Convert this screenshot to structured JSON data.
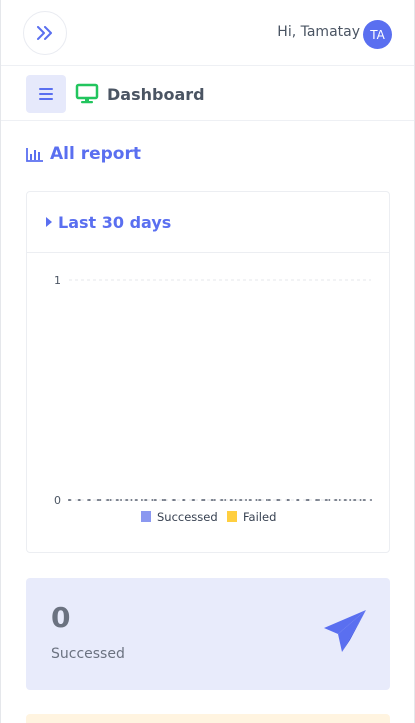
{
  "header": {
    "greeting": "Hi, Tamatay",
    "avatar_initials": "TA"
  },
  "subheader": {
    "title": "Dashboard"
  },
  "section": {
    "title": "All report"
  },
  "report_card": {
    "period_label": "Last 30 days"
  },
  "chart_data": {
    "type": "line",
    "ylim": [
      0,
      1
    ],
    "y_ticks": [
      "0",
      "1"
    ],
    "series": [
      {
        "name": "Successed",
        "color": "#8b98f0",
        "values": [
          0,
          0,
          0,
          0,
          0,
          0,
          0,
          0,
          0,
          0,
          0,
          0,
          0,
          0,
          0,
          0,
          0,
          0,
          0,
          0,
          0,
          0,
          0,
          0,
          0,
          0,
          0,
          0,
          0,
          0
        ]
      },
      {
        "name": "Failed",
        "color": "#ffcf40",
        "values": [
          0,
          0,
          0,
          0,
          0,
          0,
          0,
          0,
          0,
          0,
          0,
          0,
          0,
          0,
          0,
          0,
          0,
          0,
          0,
          0,
          0,
          0,
          0,
          0,
          0,
          0,
          0,
          0,
          0,
          0
        ]
      }
    ],
    "grid": true,
    "legend": "bottom"
  },
  "stats": [
    {
      "value": "0",
      "label": "Successed",
      "icon": "paper-plane-icon"
    }
  ],
  "colors": {
    "accent": "#5a6ff0",
    "success_bg": "#e8ebfb",
    "warning_bg": "#fff4e0",
    "dashboard_icon": "#22c55e"
  }
}
